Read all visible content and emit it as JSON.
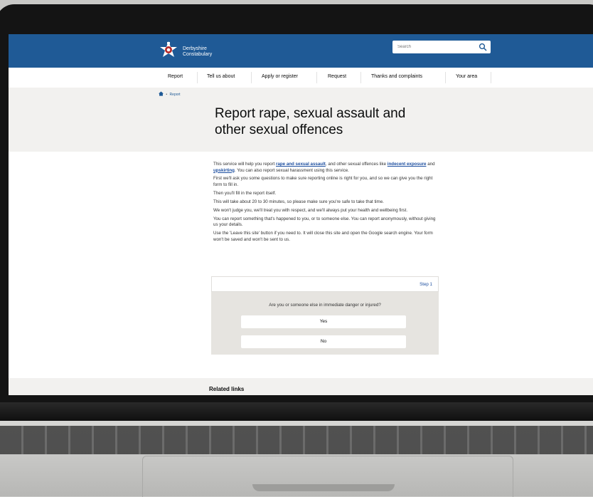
{
  "header": {
    "brand_line1": "Derbyshire",
    "brand_line2": "Constabulary",
    "search_placeholder": "Search",
    "bg_color": "#1f5a96"
  },
  "nav": {
    "items": [
      "Report",
      "Tell us about",
      "Apply or register",
      "Request",
      "Thanks and complaints",
      "Your area"
    ]
  },
  "breadcrumb": {
    "home_icon": "home-icon",
    "separator": "•",
    "current": "Report"
  },
  "page": {
    "title": "Report rape, sexual assault and other sexual offences"
  },
  "intro": {
    "p1_a": "This service will help you report ",
    "p1_link1": "rape and sexual assault",
    "p1_b": ", and other sexual offences like ",
    "p1_link2": "indecent exposure",
    "p1_c": " and ",
    "p1_link3": "upskirting",
    "p1_d": ". You can also report sexual harassment using this service.",
    "p2": "First we'll ask you some questions to make sure reporting online is right for you, and so we can give you the right form to fill in.",
    "p3": "Then you'll fill in the report itself.",
    "p4": "This will take about 20 to 30 minutes, so please make sure you're safe to take that time.",
    "p5": "We won't judge you, we'll treat you with respect, and we'll always put your health and wellbeing first.",
    "p6": "You can report something that's happened to you, or to someone else. You can report anonymously, without giving us your details.",
    "p7": "Use the 'Leave this site' button if you need to. It will close this site and open the Google search engine. Your form won't be saved and won't be sent to us."
  },
  "question": {
    "step": "Step 1",
    "text": "Are you or someone else in immediate danger or injured?",
    "yes": "Yes",
    "no": "No"
  },
  "related": {
    "title": "Related links"
  },
  "colors": {
    "link": "#1d4fa0",
    "card": "#e6e4e0"
  }
}
